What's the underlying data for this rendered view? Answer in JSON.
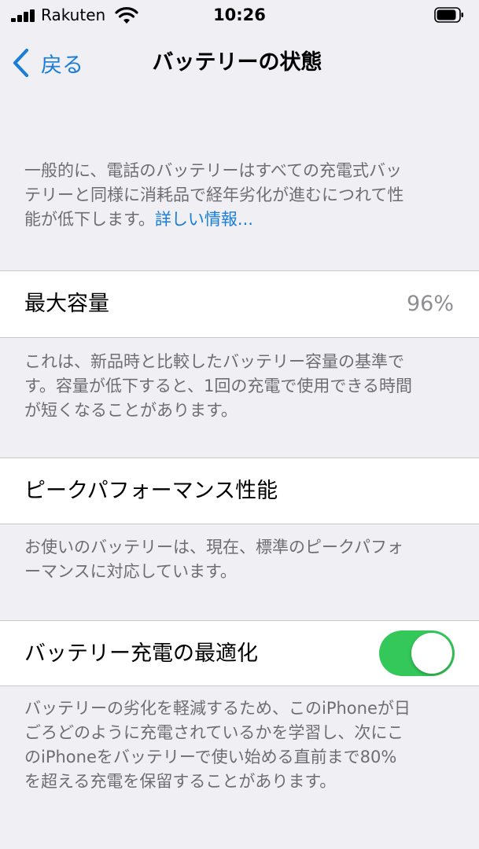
{
  "status_bar": {
    "carrier": "Rakuten",
    "time": "10:26"
  },
  "nav": {
    "back_label": "戻る",
    "title": "バッテリーの状態"
  },
  "intro": {
    "lines": [
      "一般的に、電話のバッテリーはすべての充電式バッ",
      "テリーと同様に消耗品で経年劣化が進むにつれて性",
      "能が低下します。"
    ],
    "link": "詳しい情報..."
  },
  "max_capacity": {
    "label": "最大容量",
    "value": "96%",
    "footer_lines": [
      "これは、新品時と比較したバッテリー容量の基準で",
      "す。容量が低下すると、1回の充電で使用できる時間",
      "が短くなることがあります。"
    ]
  },
  "peak_performance": {
    "label": "ピークパフォーマンス性能",
    "footer_lines": [
      "お使いのバッテリーは、現在、標準のピークパフォ",
      "ーマンスに対応しています。"
    ]
  },
  "optimized_charging": {
    "label": "バッテリー充電の最適化",
    "enabled": true,
    "footer_lines": [
      "バッテリーの劣化を軽減するため、このiPhoneが日",
      "ごろどのように充電されているかを学習し、次にこ",
      "のiPhoneをバッテリーで使い始める直前まで80%",
      "を超える充電を保留することがあります。"
    ]
  },
  "colors": {
    "accent": "#1a7dd8",
    "toggle_on": "#34c759",
    "background": "#efeff4"
  },
  "icons": {
    "signal": "cellular-signal-icon",
    "wifi": "wifi-icon",
    "battery": "battery-icon",
    "back": "chevron-left-icon"
  }
}
